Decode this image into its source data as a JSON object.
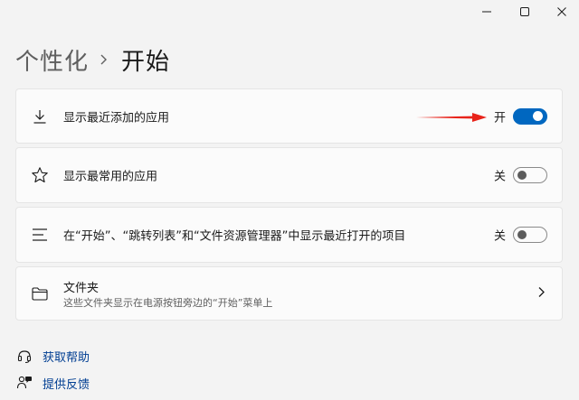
{
  "window": {
    "controls": {
      "minimize": "minimize-icon",
      "maximize": "maximize-icon",
      "close": "close-icon"
    }
  },
  "breadcrumb": {
    "parent": "个性化",
    "current": "开始"
  },
  "settings": [
    {
      "icon": "download-icon",
      "label": "显示最近添加的应用",
      "state_label": "开",
      "on": true
    },
    {
      "icon": "star-icon",
      "label": "显示最常用的应用",
      "state_label": "关",
      "on": false
    },
    {
      "icon": "list-icon",
      "label": "在“开始”、“跳转列表”和“文件资源管理器”中显示最近打开的项目",
      "state_label": "关",
      "on": false
    },
    {
      "icon": "folder-icon",
      "label": "文件夹",
      "description": "这些文件夹显示在电源按钮旁边的“开始”菜单上"
    }
  ],
  "links": [
    {
      "icon": "help-icon",
      "label": "获取帮助"
    },
    {
      "icon": "feedback-icon",
      "label": "提供反馈"
    }
  ],
  "colors": {
    "accent": "#0067c0",
    "annotation_arrow": "#e8231a",
    "link": "#003e92",
    "background": "#f3f3f3",
    "card": "#fbfbfb"
  }
}
